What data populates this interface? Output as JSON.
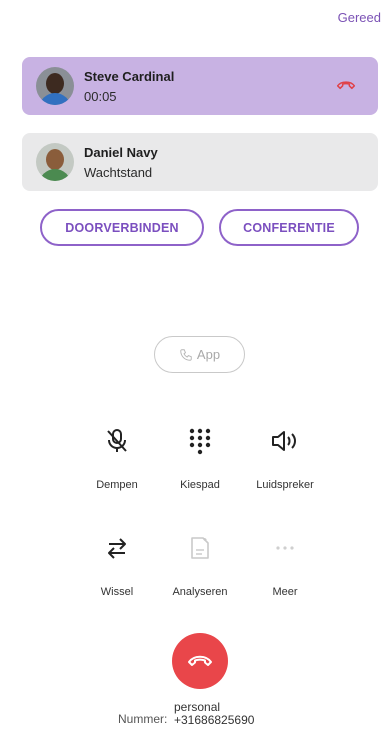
{
  "header": {
    "done_label": "Gereed"
  },
  "calls": [
    {
      "name": "Steve Cardinal",
      "status": "00:05",
      "state": "active"
    },
    {
      "name": "Daniel Navy",
      "status": "Wachtstand",
      "state": "held"
    }
  ],
  "call_actions": {
    "transfer_label": "DOORVERBINDEN",
    "conference_label": "CONFERENTIE"
  },
  "app_button": {
    "label": "App",
    "icon": "phone-icon"
  },
  "controls": [
    {
      "label": "Dempen",
      "icon": "mic-off-icon"
    },
    {
      "label": "Kiespad",
      "icon": "keypad-icon"
    },
    {
      "label": "Luidspreker",
      "icon": "speaker-icon"
    },
    {
      "label": "Wissel",
      "icon": "swap-icon"
    },
    {
      "label": "Analyseren",
      "icon": "analyze-icon",
      "disabled": true
    },
    {
      "label": "Meer",
      "icon": "more-icon",
      "disabled": true
    }
  ],
  "footer": {
    "number_label": "Nummer:",
    "line_label": "personal",
    "number": "+31686825690"
  },
  "colors": {
    "accent": "#7b52b5",
    "active_card": "#c8b2e3",
    "held_card": "#e9e9ea",
    "end_call": "#e9464a"
  }
}
